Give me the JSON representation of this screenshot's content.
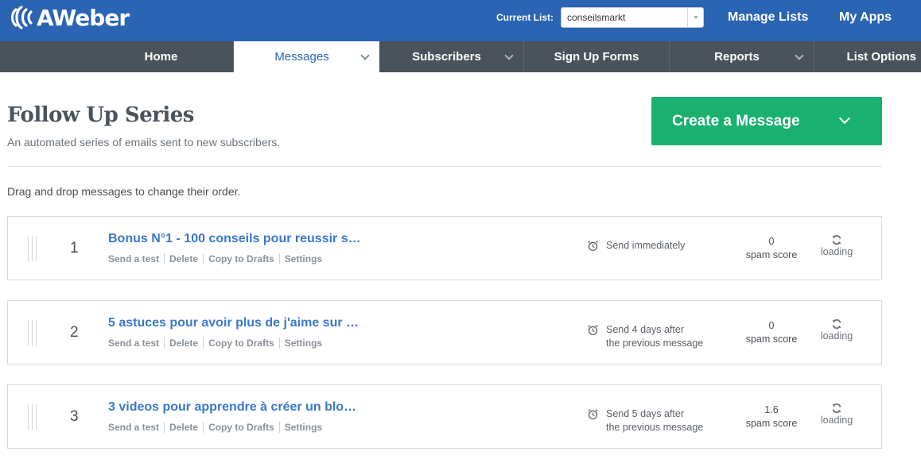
{
  "app": {
    "logo_text": "AWeber",
    "current_list_label": "Current List:",
    "current_list_value": "conseilsmarkt",
    "manage_lists": "Manage Lists",
    "my_apps": "My Apps"
  },
  "nav": {
    "items": [
      {
        "label": "Home"
      },
      {
        "label": "Messages"
      },
      {
        "label": "Subscribers"
      },
      {
        "label": "Sign Up Forms"
      },
      {
        "label": "Reports"
      },
      {
        "label": "List Options"
      }
    ]
  },
  "page": {
    "title": "Follow Up Series",
    "subtitle": "An automated series of emails sent to new subscribers.",
    "create_button": "Create a Message",
    "drag_hint": "Drag and drop messages to change their order."
  },
  "row_actions": [
    "Send a test",
    "Delete",
    "Copy to Drafts",
    "Settings"
  ],
  "messages": [
    {
      "number": "1",
      "subject": "Bonus N°1 - 100 conseils pour reussir s…",
      "send_line1": "Send immediately",
      "send_line2": "",
      "spam_value": "0",
      "spam_label": "spam score",
      "status": "loading"
    },
    {
      "number": "2",
      "subject": "5 astuces pour avoir plus de j'aime sur …",
      "send_line1": "Send 4 days after",
      "send_line2": "the previous message",
      "spam_value": "0",
      "spam_label": "spam score",
      "status": "loading"
    },
    {
      "number": "3",
      "subject": "3 videos pour apprendre à créer un blo…",
      "send_line1": "Send 5 days after",
      "send_line2": "the previous message",
      "spam_value": "1.6",
      "spam_label": "spam score",
      "status": "loading"
    }
  ],
  "colors": {
    "topbar": "#2a64b3",
    "nav": "#4a535c",
    "create_button": "#1ab06f",
    "link": "#3a78c9"
  }
}
